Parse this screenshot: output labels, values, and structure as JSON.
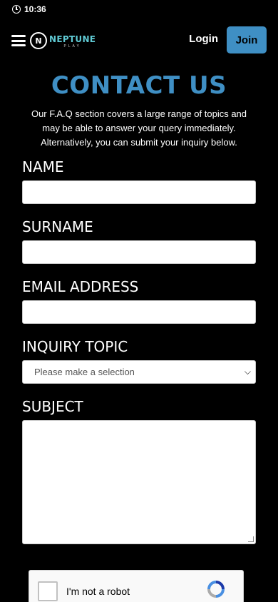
{
  "status_bar": {
    "time": "10:36"
  },
  "header": {
    "logo_mark": "N",
    "logo_main": "NEPTUNE",
    "logo_sub": "PLAY",
    "login_label": "Login",
    "join_label": "Join"
  },
  "page": {
    "title": "CONTACT US",
    "intro": "Our F.A.Q section covers a large range of topics and may be able to answer your query immediately. Alternatively, you can submit your inquiry below."
  },
  "form": {
    "name_label": "NAME",
    "surname_label": "SURNAME",
    "email_label": "EMAIL ADDRESS",
    "topic_label": "INQUIRY TOPIC",
    "topic_selected": "Please make a selection",
    "subject_label": "SUBJECT"
  },
  "recaptcha": {
    "label": "I'm not a robot"
  },
  "colors": {
    "accent": "#3f8fc4",
    "logo": "#5fc9d3",
    "background": "#000000"
  }
}
